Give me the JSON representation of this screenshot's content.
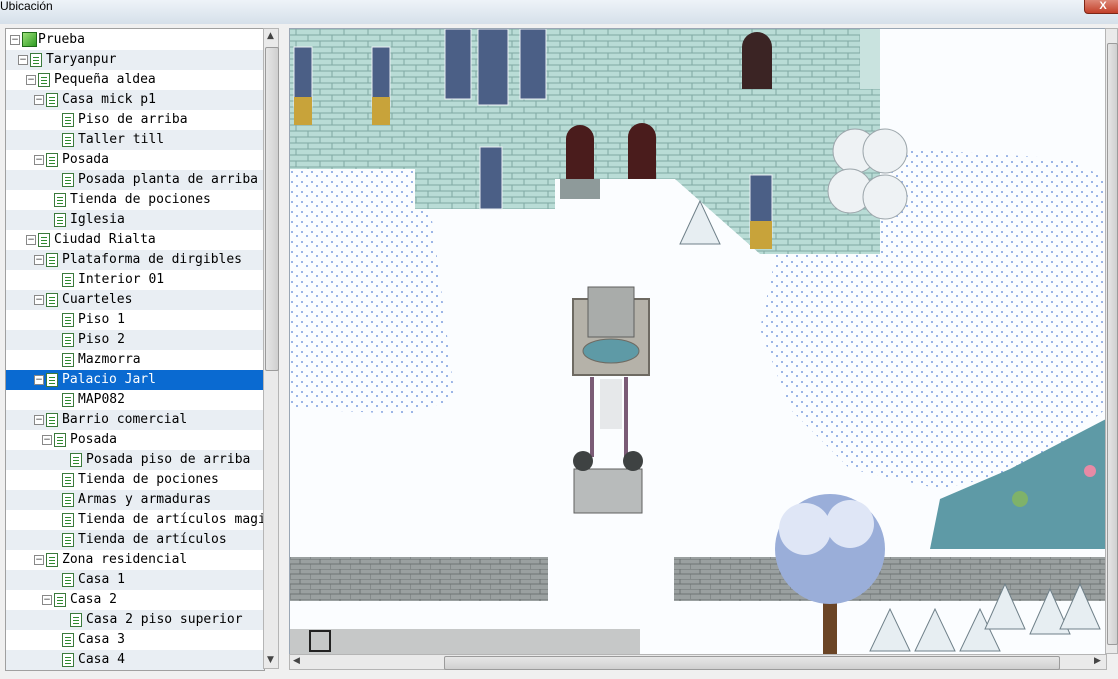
{
  "window": {
    "title": "Ubicación",
    "close_label": "X"
  },
  "tree": {
    "root": "Prueba",
    "items": [
      {
        "label": "Prueba",
        "depth": 0,
        "expander": true,
        "icon": "project-cube-icon"
      },
      {
        "label": "Taryanpur",
        "depth": 1,
        "expander": true,
        "icon": "map-icon"
      },
      {
        "label": "Pequeña aldea",
        "depth": 2,
        "expander": true,
        "icon": "map-icon"
      },
      {
        "label": "Casa mick p1",
        "depth": 3,
        "expander": true,
        "icon": "map-icon"
      },
      {
        "label": "Piso de arriba",
        "depth": 4,
        "expander": false,
        "icon": "map-icon"
      },
      {
        "label": "Taller till",
        "depth": 4,
        "expander": false,
        "icon": "map-icon"
      },
      {
        "label": "Posada",
        "depth": 3,
        "expander": true,
        "icon": "map-icon"
      },
      {
        "label": "Posada planta de arriba",
        "depth": 4,
        "expander": false,
        "icon": "map-icon"
      },
      {
        "label": "Tienda de pociones",
        "depth": 3,
        "expander": false,
        "icon": "map-icon"
      },
      {
        "label": "Iglesia",
        "depth": 3,
        "expander": false,
        "icon": "map-icon"
      },
      {
        "label": "Ciudad Rialta",
        "depth": 2,
        "expander": true,
        "icon": "map-icon"
      },
      {
        "label": "Plataforma de dirgibles",
        "depth": 3,
        "expander": true,
        "icon": "map-icon"
      },
      {
        "label": "Interior 01",
        "depth": 4,
        "expander": false,
        "icon": "map-icon"
      },
      {
        "label": "Cuarteles",
        "depth": 3,
        "expander": true,
        "icon": "map-icon"
      },
      {
        "label": "Piso 1",
        "depth": 4,
        "expander": false,
        "icon": "map-icon"
      },
      {
        "label": "Piso 2",
        "depth": 4,
        "expander": false,
        "icon": "map-icon"
      },
      {
        "label": "Mazmorra",
        "depth": 4,
        "expander": false,
        "icon": "map-icon"
      },
      {
        "label": "Palacio Jarl",
        "depth": 3,
        "expander": true,
        "icon": "map-icon",
        "selected": true
      },
      {
        "label": "MAP082",
        "depth": 4,
        "expander": false,
        "icon": "map-icon"
      },
      {
        "label": "Barrio comercial",
        "depth": 3,
        "expander": true,
        "icon": "map-icon"
      },
      {
        "label": "Posada",
        "depth": 4,
        "expander": true,
        "icon": "map-icon"
      },
      {
        "label": "Posada piso de arriba",
        "depth": 5,
        "expander": false,
        "icon": "map-icon"
      },
      {
        "label": "Tienda de pociones",
        "depth": 4,
        "expander": false,
        "icon": "map-icon"
      },
      {
        "label": "Armas y armaduras",
        "depth": 4,
        "expander": false,
        "icon": "map-icon"
      },
      {
        "label": "Tienda de artículos magicos",
        "depth": 4,
        "expander": false,
        "icon": "map-icon"
      },
      {
        "label": "Tienda de artículos",
        "depth": 4,
        "expander": false,
        "icon": "map-icon"
      },
      {
        "label": "Zona residencial",
        "depth": 3,
        "expander": true,
        "icon": "map-icon"
      },
      {
        "label": "Casa 1",
        "depth": 4,
        "expander": false,
        "icon": "map-icon"
      },
      {
        "label": "Casa 2",
        "depth": 4,
        "expander": true,
        "icon": "map-icon"
      },
      {
        "label": "Casa 2 piso superior",
        "depth": 5,
        "expander": false,
        "icon": "map-icon"
      },
      {
        "label": "Casa 3",
        "depth": 4,
        "expander": false,
        "icon": "map-icon"
      },
      {
        "label": "Casa 4",
        "depth": 4,
        "expander": false,
        "icon": "map-icon"
      }
    ]
  },
  "colors": {
    "selection": "#0a6ad1",
    "snow": "#fbfdff",
    "stone": "#b9dcd6",
    "water": "#5e9aa6"
  },
  "map_preview": {
    "name": "Palacio Jarl",
    "icons": [
      "castle-icon",
      "fountain-statue-icon",
      "tree-icon",
      "pine-tree-icon",
      "cursor-tile-icon"
    ]
  }
}
